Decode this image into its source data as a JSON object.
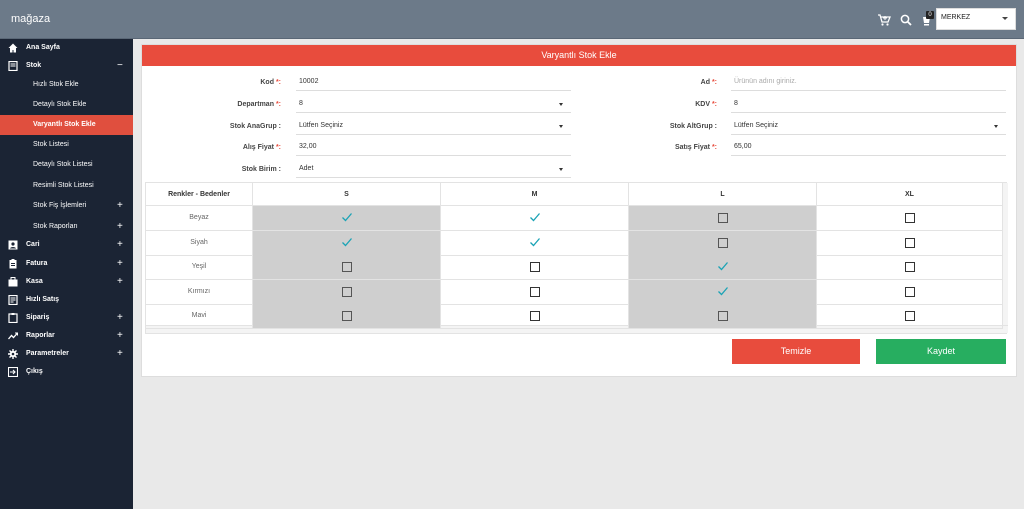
{
  "app": {
    "brand": "mağaza",
    "branch": "MERKEZ",
    "cart_badge": "0"
  },
  "icons": [
    "cart-icon",
    "search-icon",
    "cart-badge-icon"
  ],
  "sidebar": {
    "items": [
      {
        "label": "Ana Sayfa",
        "icon": "home-icon"
      },
      {
        "label": "Stok",
        "icon": "stock-icon",
        "toggle": "−"
      },
      {
        "label": "Cari",
        "icon": "contact-icon",
        "toggle": "+"
      },
      {
        "label": "Fatura",
        "icon": "invoice-icon",
        "toggle": "+"
      },
      {
        "label": "Kasa",
        "icon": "cash-icon",
        "toggle": "+"
      },
      {
        "label": "Hızlı Satış",
        "icon": "quick-sale-icon"
      },
      {
        "label": "Sipariş",
        "icon": "order-icon",
        "toggle": "+"
      },
      {
        "label": "Raporlar",
        "icon": "report-icon",
        "toggle": "+"
      },
      {
        "label": "Parametreler",
        "icon": "gear-icon",
        "toggle": "+"
      },
      {
        "label": "Çıkış",
        "icon": "logout-icon"
      }
    ],
    "subitems": [
      {
        "label": "Hızlı Stok Ekle"
      },
      {
        "label": "Detaylı Stok Ekle"
      },
      {
        "label": "Varyantlı Stok Ekle",
        "active": true
      },
      {
        "label": "Stok Listesi"
      },
      {
        "label": "Detaylı Stok Listesi"
      },
      {
        "label": "Resimli Stok Listesi"
      },
      {
        "label": "Stok Fiş İşlemleri",
        "toggle": "+"
      },
      {
        "label": "Stok Raporları",
        "toggle": "+"
      }
    ]
  },
  "panel": {
    "title": "Varyantlı Stok Ekle"
  },
  "form": {
    "kod": {
      "label": "Kod",
      "req": "*:",
      "value": "10002"
    },
    "departman": {
      "label": "Departman",
      "req": "*:",
      "value": "8"
    },
    "anagrup": {
      "label": "Stok AnaGrup :",
      "value": "Lütfen Seçiniz"
    },
    "alis": {
      "label": "Alış Fiyat",
      "req": "*:",
      "value": "32,00"
    },
    "birim": {
      "label": "Stok Birim :",
      "value": "Adet"
    },
    "ad": {
      "label": "Ad",
      "req": "*:",
      "placeholder": "Ürünün adını giriniz."
    },
    "kdv": {
      "label": "KDV",
      "req": "*:",
      "value": "8"
    },
    "altgrup": {
      "label": "Stok AltGrup :",
      "value": "Lütfen Seçiniz"
    },
    "satis": {
      "label": "Satış Fiyat",
      "req": "*:",
      "value": "65,00"
    }
  },
  "variant_grid": {
    "corner": "Renkler - Bedenler",
    "sizes": [
      "S",
      "M",
      "L",
      "XL"
    ],
    "colors": [
      "Beyaz",
      "Siyah",
      "Yeşil",
      "Kırmızı",
      "Mavi"
    ],
    "checked": [
      [
        true,
        true,
        false,
        false
      ],
      [
        true,
        true,
        false,
        false
      ],
      [
        false,
        false,
        true,
        false
      ],
      [
        false,
        false,
        true,
        false
      ],
      [
        false,
        false,
        false,
        false
      ]
    ]
  },
  "buttons": {
    "clear": "Temizle",
    "save": "Kaydet"
  }
}
